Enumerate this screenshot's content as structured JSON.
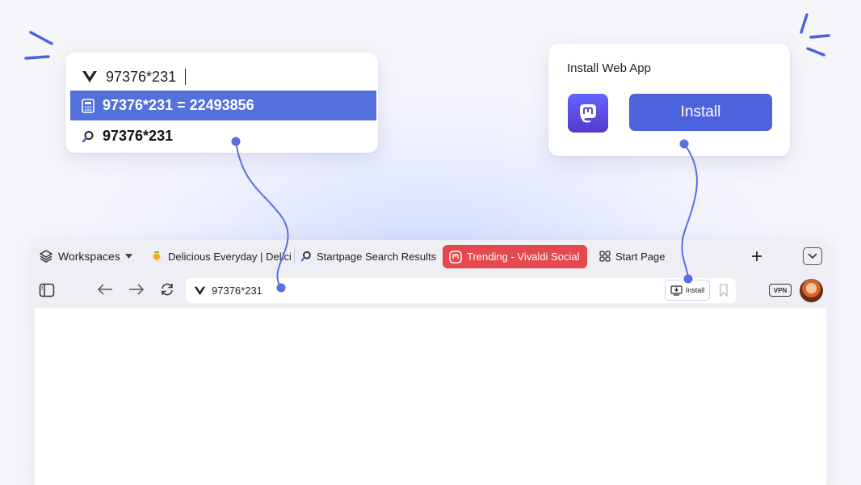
{
  "suggestions": {
    "query": "97376*231",
    "items": [
      {
        "text": "97376*231 = 22493856",
        "icon": "calculator-icon"
      },
      {
        "text": "97376*231",
        "icon": "search-icon"
      }
    ]
  },
  "install_popup": {
    "title": "Install Web App",
    "button_label": "Install",
    "app_icon": "mastodon-icon"
  },
  "browser": {
    "workspaces_label": "Workspaces",
    "tabs": [
      {
        "label": "Delicious Everyday | Delici",
        "icon": "tomato-icon"
      },
      {
        "label": "Startpage Search Results",
        "icon": "search-icon"
      },
      {
        "label": "Trending - Vivaldi Social",
        "icon": "mastodon-icon",
        "active": true
      },
      {
        "label": "Start Page",
        "icon": "grid-icon"
      }
    ],
    "address": "97376*231",
    "install_badge": "Install",
    "vpn_label": "VPN"
  },
  "colors": {
    "accent": "#5470dc",
    "active_tab": "#e5484d",
    "connector": "#5a6fe0"
  }
}
